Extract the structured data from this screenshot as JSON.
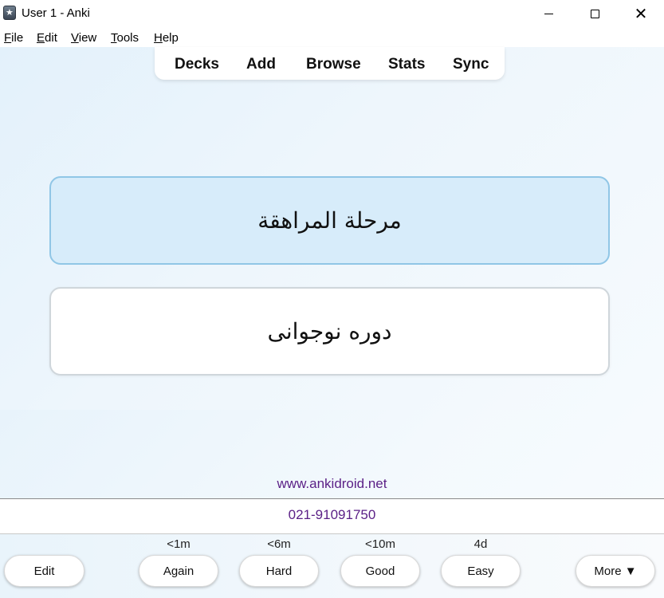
{
  "window": {
    "title": "User 1 - Anki"
  },
  "menu": [
    {
      "key": "F",
      "rest": "ile"
    },
    {
      "key": "E",
      "rest": "dit"
    },
    {
      "key": "V",
      "rest": "iew"
    },
    {
      "key": "T",
      "rest": "ools"
    },
    {
      "key": "H",
      "rest": "elp"
    }
  ],
  "toolbar": [
    "Decks",
    "Add",
    "Browse",
    "Stats",
    "Sync"
  ],
  "card": {
    "front": "مرحلة المراهقة",
    "back": "دوره نوجوانی"
  },
  "footer": {
    "link": "www.ankidroid.net",
    "phone": "021-91091750"
  },
  "answer_bar": {
    "edit_label": "Edit",
    "more_label": "More ▼",
    "buttons": [
      {
        "label": "Again",
        "interval": "<1m"
      },
      {
        "label": "Hard",
        "interval": "<6m"
      },
      {
        "label": "Good",
        "interval": "<10m"
      },
      {
        "label": "Easy",
        "interval": "4d"
      }
    ]
  },
  "icons": {
    "app": "anki-star-icon",
    "minimize": "minimize-icon",
    "maximize": "maximize-icon",
    "close": "close-icon"
  },
  "colors": {
    "card_front_bg": "#d7ecfa",
    "card_front_border": "#90c6e6",
    "link_color": "#5a1f86"
  }
}
